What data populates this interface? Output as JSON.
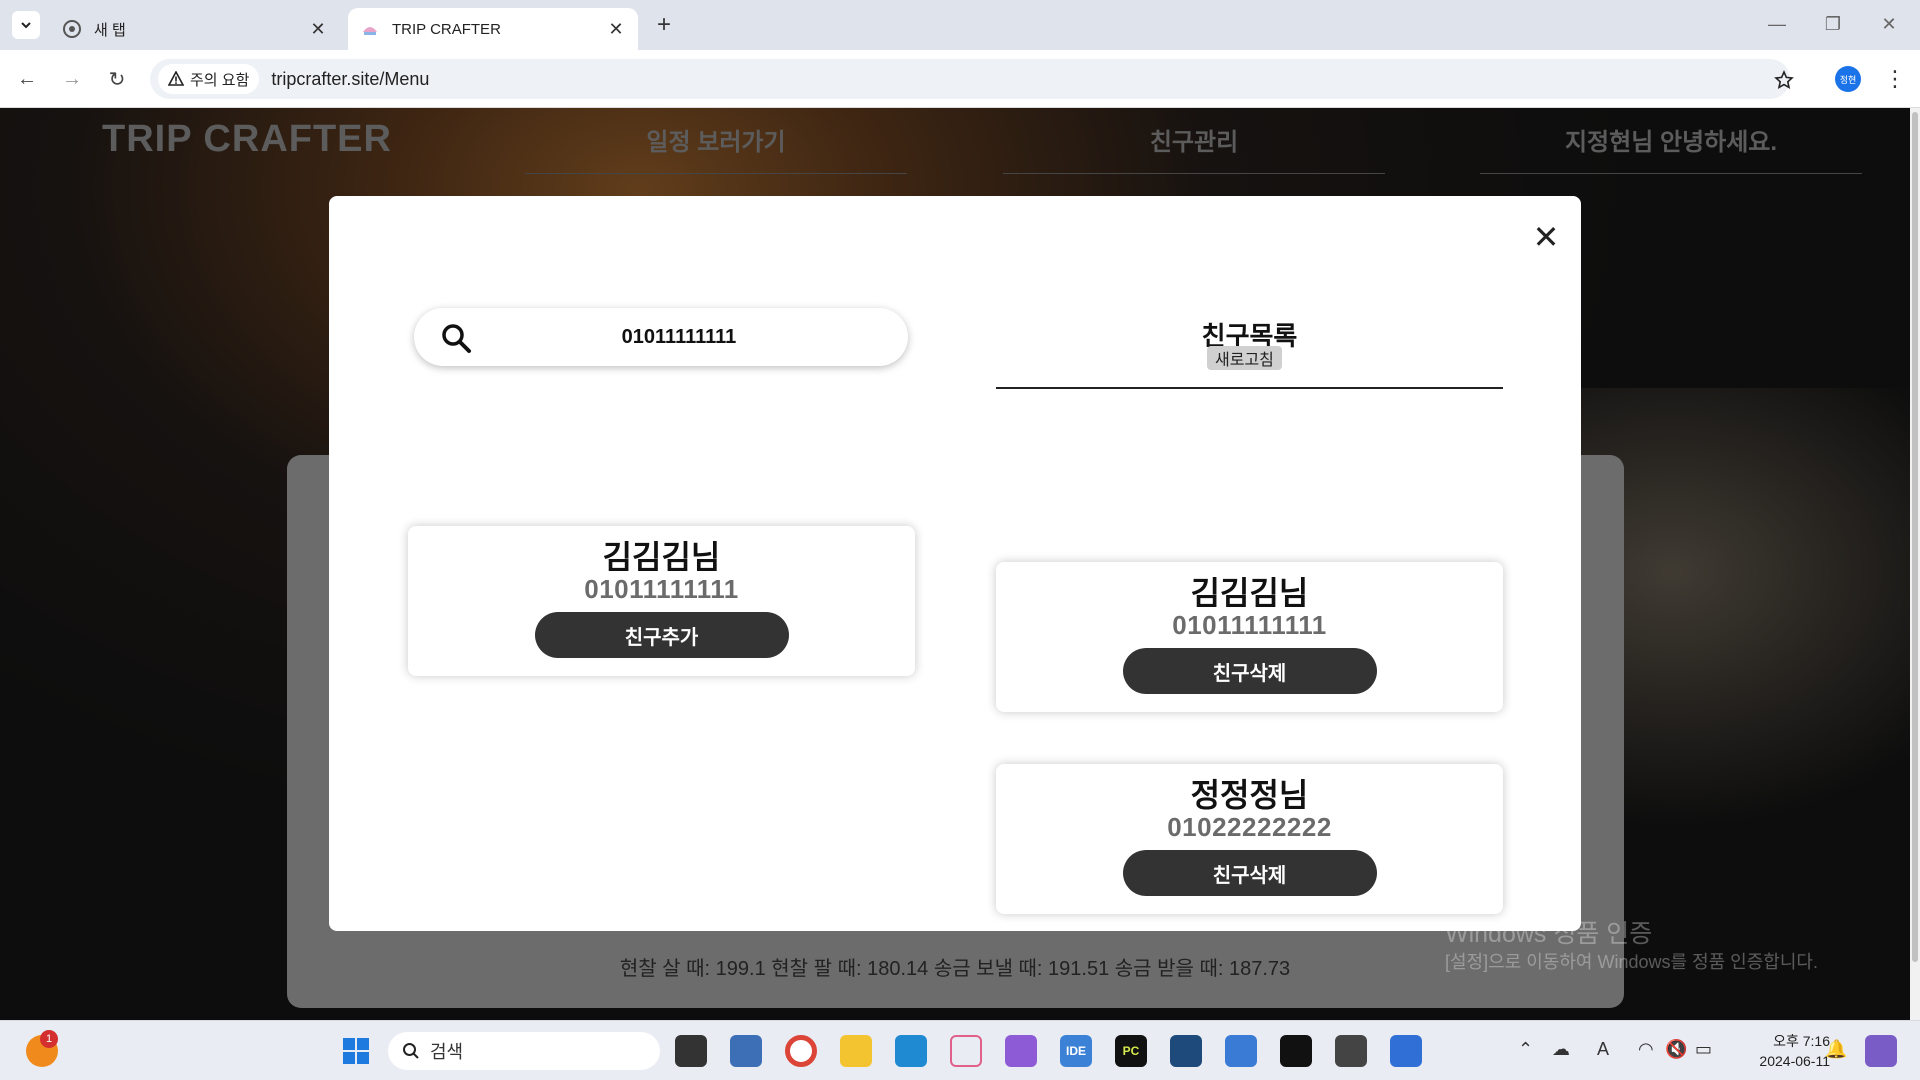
{
  "browser": {
    "tabs": [
      {
        "title": "새 탭",
        "active": false
      },
      {
        "title": "TRIP CRAFTER",
        "active": true
      }
    ],
    "security_chip": "주의 요함",
    "url": "tripcrafter.site/Menu",
    "profile_initials": "정현"
  },
  "site": {
    "brand": "TRIP CRAFTER",
    "nav": [
      "일정 보러가기",
      "친구관리",
      "지정현님 안녕하세요."
    ],
    "rates_text": "현찰 살 때: 199.1 현찰 팔 때: 180.14 송금 보낼 때: 191.51 송금 받을 때: 187.73"
  },
  "modal": {
    "search_value": "01011111111",
    "search_result": {
      "name": "김김김님",
      "phone": "01011111111",
      "button": "친구추가"
    },
    "friends_title": "친구목록",
    "refresh_label": "새로고침",
    "friends": [
      {
        "name": "김김김님",
        "phone": "01011111111",
        "button": "친구삭제"
      },
      {
        "name": "정정정님",
        "phone": "01022222222",
        "button": "친구삭제"
      }
    ]
  },
  "watermark": {
    "line1": "Windows 정품 인증",
    "line2": "[설정]으로 이동하여 Windows를 정품 인증합니다."
  },
  "taskbar": {
    "search_placeholder": "검색",
    "notification_count": "1",
    "time": "오후 7:16",
    "date": "2024-06-11"
  },
  "colors": {
    "modal_button": "#333333",
    "phone_gray": "#6b6b6b",
    "profile_blue": "#1a73e8"
  }
}
